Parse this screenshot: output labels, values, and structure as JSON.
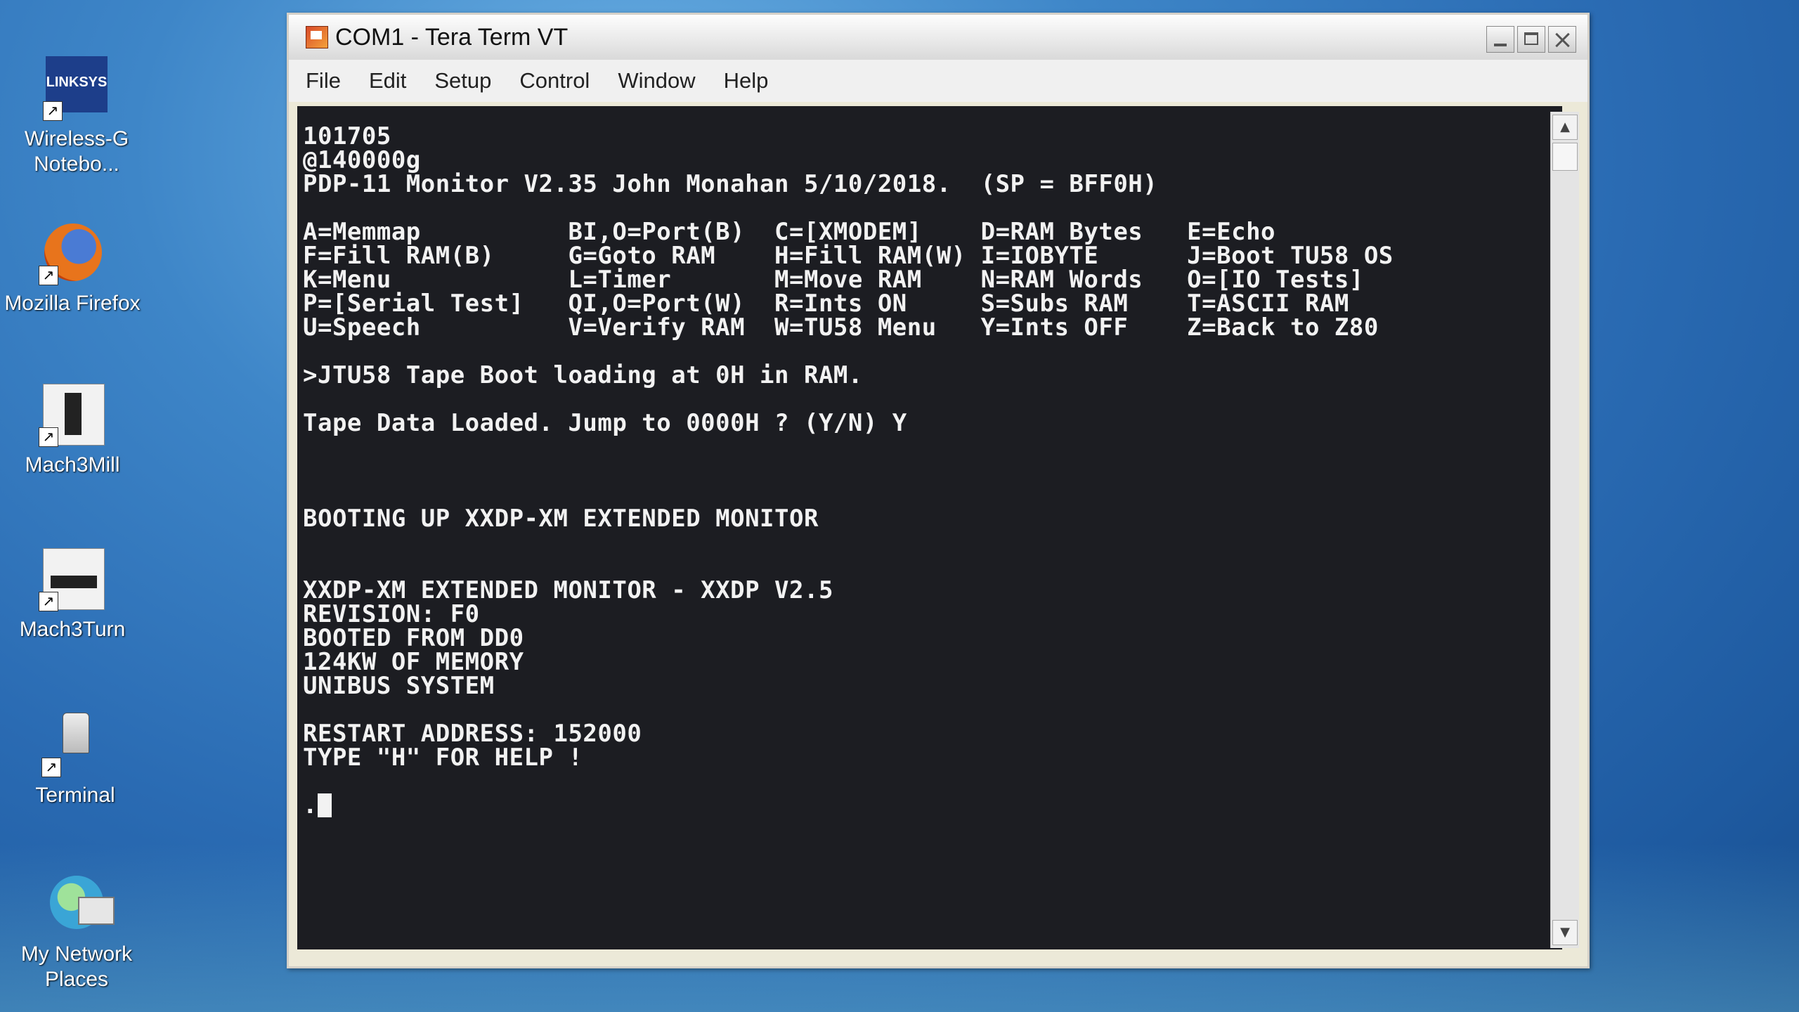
{
  "desktop": {
    "icons": [
      {
        "label": "Wireless-G\nNotebo...",
        "logo_text": "LINKSYS",
        "icon": "linksys-icon"
      },
      {
        "label": "Mozilla Firefox",
        "icon": "firefox-icon"
      },
      {
        "label": "Mach3Mill",
        "icon": "mach3mill-icon"
      },
      {
        "label": "Mach3Turn",
        "icon": "mach3turn-icon"
      },
      {
        "label": "Terminal",
        "icon": "terminal-icon"
      },
      {
        "label": "My Network\nPlaces",
        "icon": "network-places-icon"
      }
    ]
  },
  "window": {
    "title": "COM1 - Tera Term VT",
    "menu": [
      "File",
      "Edit",
      "Setup",
      "Control",
      "Window",
      "Help"
    ]
  },
  "terminal": {
    "lines": [
      "101705",
      "@140000g",
      "PDP-11 Monitor V2.35 John Monahan 5/10/2018.  (SP = BFF0H)",
      "",
      "A=Memmap          BI,O=Port(B)  C=[XMODEM]    D=RAM Bytes   E=Echo",
      "F=Fill RAM(B)     G=Goto RAM    H=Fill RAM(W) I=IOBYTE      J=Boot TU58 OS",
      "K=Menu            L=Timer       M=Move RAM    N=RAM Words   O=[IO Tests]",
      "P=[Serial Test]   QI,O=Port(W)  R=Ints ON     S=Subs RAM    T=ASCII RAM",
      "U=Speech          V=Verify RAM  W=TU58 Menu   Y=Ints OFF    Z=Back to Z80",
      "",
      ">JTU58 Tape Boot loading at 0H in RAM.",
      "",
      "Tape Data Loaded. Jump to 0000H ? (Y/N) Y",
      "",
      "",
      "",
      "BOOTING UP XXDP-XM EXTENDED MONITOR",
      "",
      "",
      "XXDP-XM EXTENDED MONITOR - XXDP V2.5",
      "REVISION: F0",
      "BOOTED FROM DD0",
      "124KW OF MEMORY",
      "UNIBUS SYSTEM",
      "",
      "RESTART ADDRESS: 152000",
      "TYPE \"H\" FOR HELP !",
      "",
      "."
    ]
  },
  "colors": {
    "terminal_bg": "#1c1d22",
    "terminal_fg": "#f2f2f2",
    "desktop": "#2a6bb3"
  }
}
